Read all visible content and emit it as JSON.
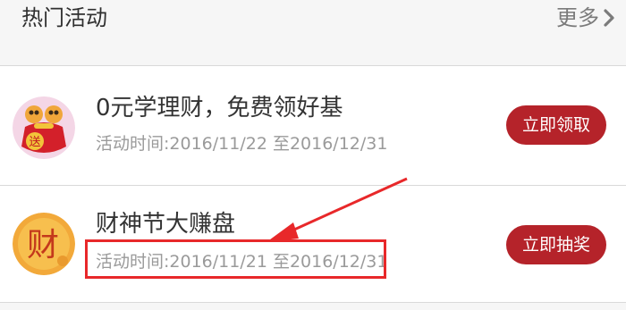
{
  "header": {
    "title": "热门活动",
    "more_label": "更多"
  },
  "activities": [
    {
      "title": "0元学理财，免费领好基",
      "time": "活动时间:2016/11/22 至2016/12/31",
      "button_label": "立即领取",
      "icon": "red-gift-bag-icon",
      "icon_text": "送"
    },
    {
      "title": "财神节大赚盘",
      "time": "活动时间:2016/11/21 至2016/12/31",
      "button_label": "立即抽奖",
      "icon": "coin-icon",
      "icon_text": "财"
    }
  ],
  "colors": {
    "accent": "#b5232a",
    "annotation": "#e8282a",
    "header_bg": "#f6f6f6"
  }
}
